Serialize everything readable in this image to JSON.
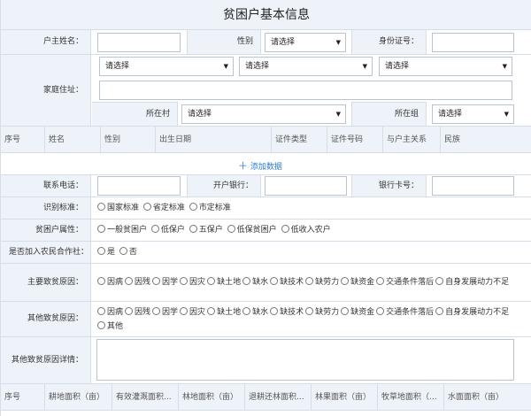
{
  "title": "贫困户基本信息",
  "labels": {
    "householder_name": "户主姓名：",
    "gender": "性别",
    "id_number": "身份证号：",
    "home_address": "家庭住址：",
    "village": "所在村",
    "group": "所在组",
    "phone": "联系电话：",
    "bank": "开户银行：",
    "bank_card": "银行卡号：",
    "standard": "识别标准：",
    "poverty_attr": "贫困户属性：",
    "coop": "是否加入农民合作社：",
    "main_cause": "主要致贫原因：",
    "other_cause": "其他致贫原因：",
    "other_detail": "其他致贫原因详情："
  },
  "select_placeholder": "请选择",
  "members_table": {
    "headers": [
      "序号",
      "姓名",
      "性别",
      "出生日期",
      "证件类型",
      "证件号码",
      "与户主关系",
      "民族"
    ],
    "add_label": "添加数据"
  },
  "standard_options": [
    "国家标准",
    "省定标准",
    "市定标准"
  ],
  "poverty_attr_options": [
    "一般贫困户",
    "低保户",
    "五保户",
    "低保贫困户",
    "低收入农户"
  ],
  "coop_options": [
    "是",
    "否"
  ],
  "main_cause_options": [
    "因病",
    "因残",
    "因学",
    "因灾",
    "缺土地",
    "缺水",
    "缺技术",
    "缺劳力",
    "缺资金",
    "交通条件落后",
    "自身发展动力不足"
  ],
  "other_cause_options": [
    "因病",
    "因残",
    "因学",
    "因灾",
    "缺土地",
    "缺水",
    "缺技术",
    "缺劳力",
    "缺资金",
    "交通条件落后",
    "自身发展动力不足",
    "其他"
  ],
  "land_table": {
    "headers": [
      "序号",
      "耕地面积（亩）",
      "有效灌溉面积...",
      "林地面积（亩）",
      "退耕还林面积...",
      "林果面积（亩）",
      "牧草地面积（...",
      "水面面积（亩）"
    ]
  }
}
